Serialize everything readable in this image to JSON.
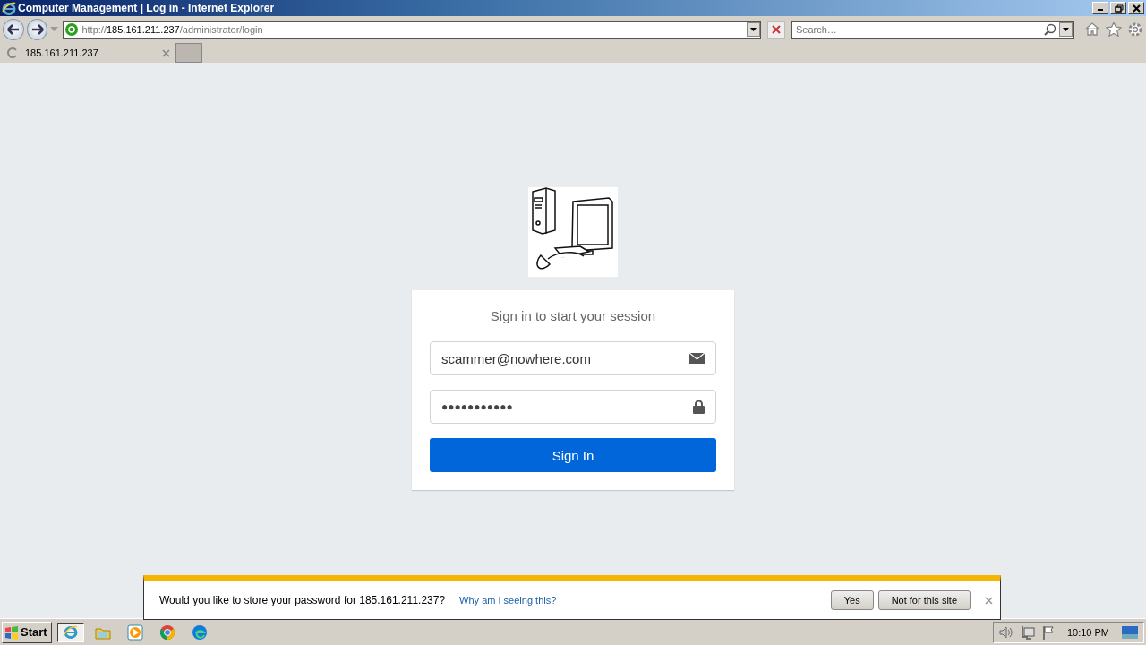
{
  "window": {
    "title": "Computer Management | Log in - Internet Explorer"
  },
  "address_bar": {
    "scheme": "http://",
    "host": "185.161.211.237",
    "path": "/administrator/login"
  },
  "search": {
    "placeholder": "Search…"
  },
  "tabs": [
    {
      "label": "185.161.211.237",
      "selected": true
    }
  ],
  "login": {
    "heading": "Sign in to start your session",
    "email": "scammer@nowhere.com",
    "password": "●●●●●●●●●●●",
    "button": "Sign In"
  },
  "password_prompt": {
    "message": "Would you like to store your password for 185.161.211.237?",
    "link": "Why am I seeing this?",
    "buttons": [
      "Yes",
      "Not for this site"
    ]
  },
  "taskbar": {
    "start": "Start",
    "apps": [
      {
        "kind": "ie",
        "selected": true
      },
      {
        "kind": "folder",
        "selected": false
      },
      {
        "kind": "media",
        "selected": false
      },
      {
        "kind": "chrome",
        "selected": false
      },
      {
        "kind": "edge",
        "selected": false
      }
    ],
    "clock": "10:10 PM"
  }
}
